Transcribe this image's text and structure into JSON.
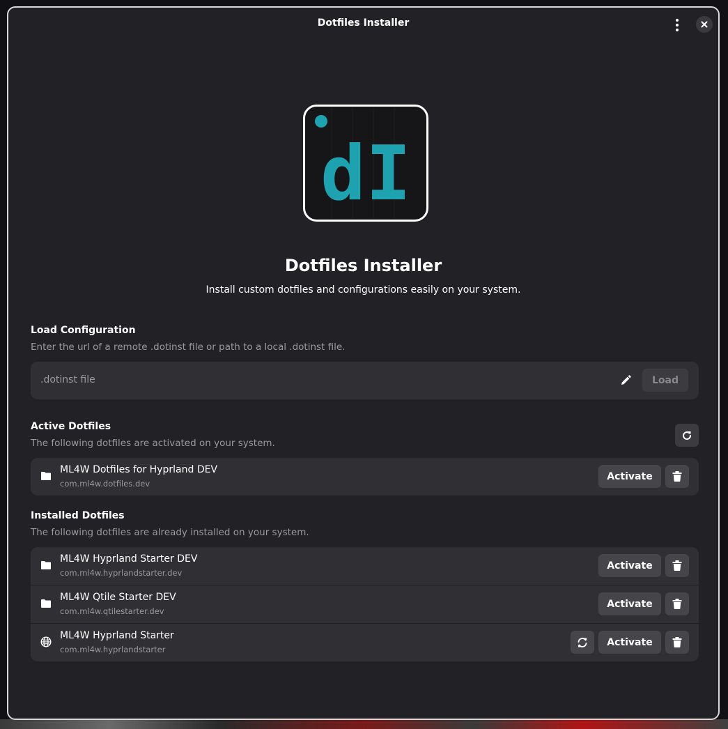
{
  "window": {
    "title": "Dotfiles Installer"
  },
  "header": {
    "menu_icon": "kebab-menu-icon",
    "close_icon": "close-icon"
  },
  "app": {
    "icon_text": "dI",
    "title": "Dotfiles Installer",
    "subtitle": "Install custom dotfiles and configurations easily on your system."
  },
  "load_config": {
    "title": "Load Configuration",
    "description": "Enter the url of a remote .dotinst file or path to a local .dotinst file.",
    "placeholder": ".dotinst file",
    "load_label": "Load"
  },
  "active": {
    "title": "Active Dotfiles",
    "description": "The following dotfiles are activated on your system.",
    "items": [
      {
        "name": "ML4W Dotfiles for Hyprland DEV",
        "id": "com.ml4w.dotfiles.dev",
        "icon": "folder-icon",
        "activate_label": "Activate"
      }
    ]
  },
  "installed": {
    "title": "Installed Dotfiles",
    "description": "The following dotfiles are already installed on your system.",
    "items": [
      {
        "name": "ML4W Hyprland Starter DEV",
        "id": "com.ml4w.hyprlandstarter.dev",
        "icon": "folder-icon",
        "activate_label": "Activate"
      },
      {
        "name": "ML4W Qtile Starter DEV",
        "id": "com.ml4w.qtilestarter.dev",
        "icon": "folder-icon",
        "activate_label": "Activate"
      },
      {
        "name": "ML4W Hyprland Starter",
        "id": "com.ml4w.hyprlandstarter",
        "icon": "globe-icon",
        "activate_label": "Activate"
      }
    ]
  },
  "colors": {
    "accent": "#1fa2b0",
    "window_bg": "#222226",
    "card_bg": "#303034",
    "button_bg": "#46464a"
  }
}
